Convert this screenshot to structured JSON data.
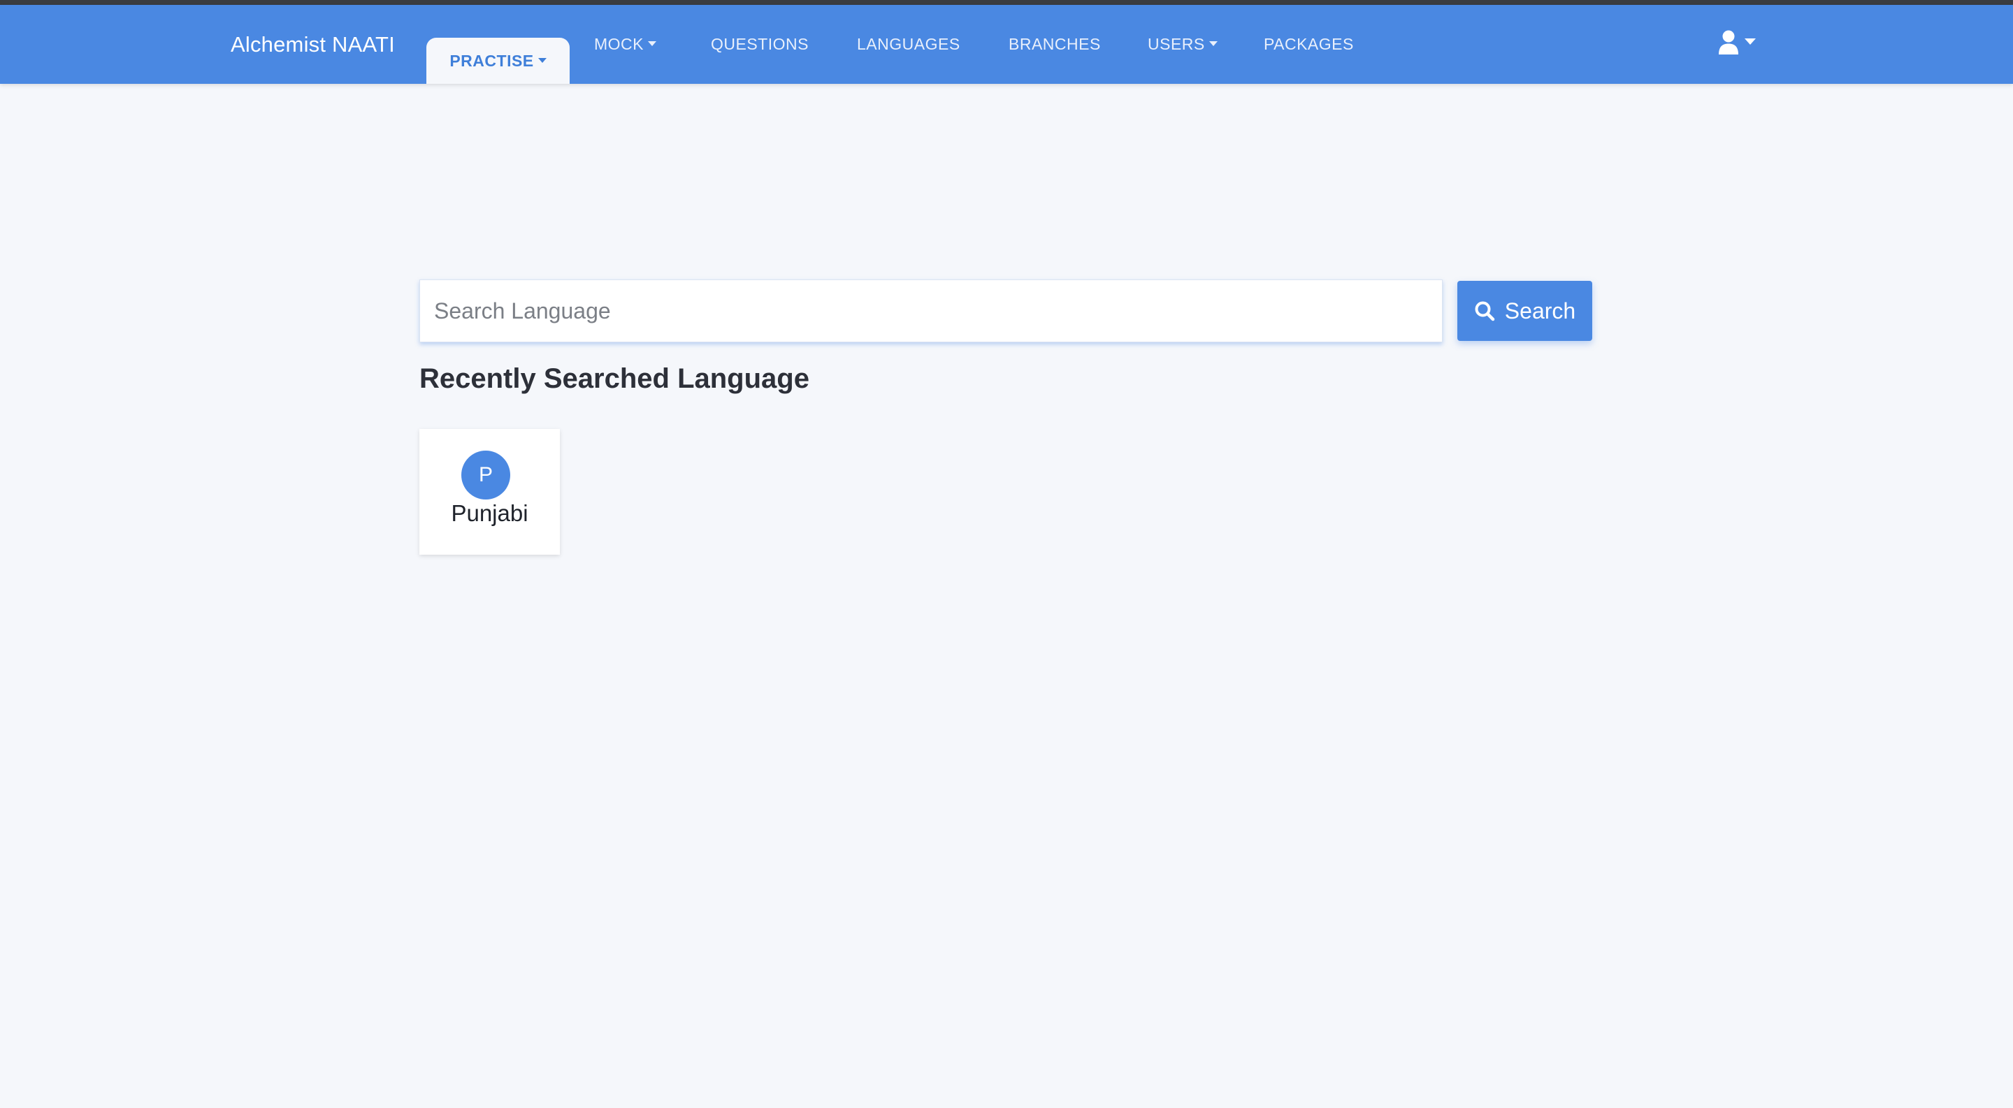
{
  "navbar": {
    "brand": "Alchemist NAATI",
    "items": [
      {
        "label": "PRACTISE",
        "dropdown": true,
        "active": true
      },
      {
        "label": "MOCK",
        "dropdown": true,
        "active": false
      },
      {
        "label": "QUESTIONS",
        "dropdown": false,
        "active": false
      },
      {
        "label": "LANGUAGES",
        "dropdown": false,
        "active": false
      },
      {
        "label": "BRANCHES",
        "dropdown": false,
        "active": false
      },
      {
        "label": "USERS",
        "dropdown": true,
        "active": false
      },
      {
        "label": "PACKAGES",
        "dropdown": false,
        "active": false
      }
    ],
    "user_icon": "user-icon"
  },
  "search": {
    "placeholder": "Search Language",
    "value": "",
    "button_label": "Search",
    "button_icon": "search-icon"
  },
  "recent": {
    "title": "Recently Searched Language",
    "languages": [
      {
        "initial": "P",
        "name": "Punjabi"
      }
    ]
  },
  "colors": {
    "primary": "#4a88e2",
    "background": "#f5f7fb",
    "title_text": "#2d3039"
  }
}
